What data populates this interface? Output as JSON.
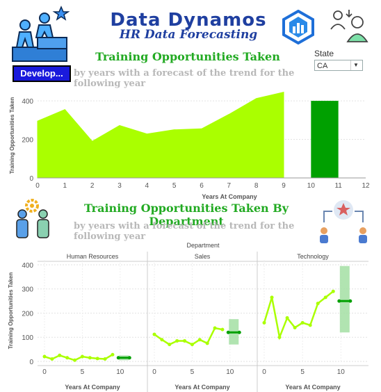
{
  "header": {
    "brand_title": "Data Dynamos",
    "brand_subtitle": "HR Data Forecasting",
    "chart1_title": "Training Opportunities Taken",
    "subtitle": "by years with a forecast of the trend for the following year",
    "chart2_title": "Training Opportunities Taken By Department",
    "dept_button_label": "Develop...",
    "state_label": "State",
    "state_value": "CA"
  },
  "colors": {
    "actual": "#aaff00",
    "forecast": "#00a000",
    "band": "#a3dfa3",
    "title_green": "#22aa22",
    "brand_blue": "#1f3fa0"
  },
  "icons": [
    "career-steps-icon",
    "data-dynamos-logo-icon",
    "employee-user-icon",
    "team-settings-icon",
    "star-exchange-icon"
  ],
  "chart_data": [
    {
      "type": "area",
      "xlabel": "Years At Company",
      "ylabel": "Training Opportunities Taken",
      "xlim": [
        0,
        12
      ],
      "ylim": [
        0,
        440
      ],
      "x_ticks": [
        0,
        1,
        2,
        3,
        4,
        5,
        6,
        7,
        8,
        9,
        10,
        11,
        12
      ],
      "y_ticks": [
        0,
        200,
        400
      ],
      "x": [
        0,
        1,
        2,
        3,
        4,
        5,
        6,
        7,
        8,
        9
      ],
      "values": [
        295,
        355,
        190,
        272,
        228,
        250,
        255,
        330,
        412,
        445
      ],
      "forecast": {
        "x_start": 10,
        "x_end": 11,
        "value": 400
      }
    },
    {
      "type": "line",
      "facet_header": "Department",
      "xlabel": "Years At Company",
      "ylabel": "Training Opportunities Taken",
      "ylim": [
        0,
        420
      ],
      "y_ticks": [
        0,
        100,
        200,
        300,
        400
      ],
      "x_ticks": [
        0,
        5,
        10
      ],
      "panels": [
        {
          "name": "Human Resources",
          "x": [
            0,
            1,
            2,
            3,
            4,
            5,
            6,
            7,
            8,
            9
          ],
          "values": [
            20,
            10,
            25,
            15,
            5,
            20,
            15,
            12,
            10,
            28
          ],
          "forecast": {
            "value": 15,
            "low": 5,
            "high": 25
          }
        },
        {
          "name": "Sales",
          "x": [
            0,
            1,
            2,
            3,
            4,
            5,
            6,
            7,
            8,
            9
          ],
          "values": [
            112,
            90,
            70,
            85,
            85,
            70,
            90,
            75,
            138,
            132
          ],
          "forecast": {
            "value": 120,
            "low": 70,
            "high": 175
          }
        },
        {
          "name": "Technology",
          "x": [
            0,
            1,
            2,
            3,
            4,
            5,
            6,
            7,
            8,
            9
          ],
          "values": [
            160,
            265,
            100,
            180,
            140,
            160,
            150,
            240,
            265,
            290
          ],
          "forecast": {
            "value": 250,
            "low": 120,
            "high": 395
          }
        }
      ]
    }
  ]
}
